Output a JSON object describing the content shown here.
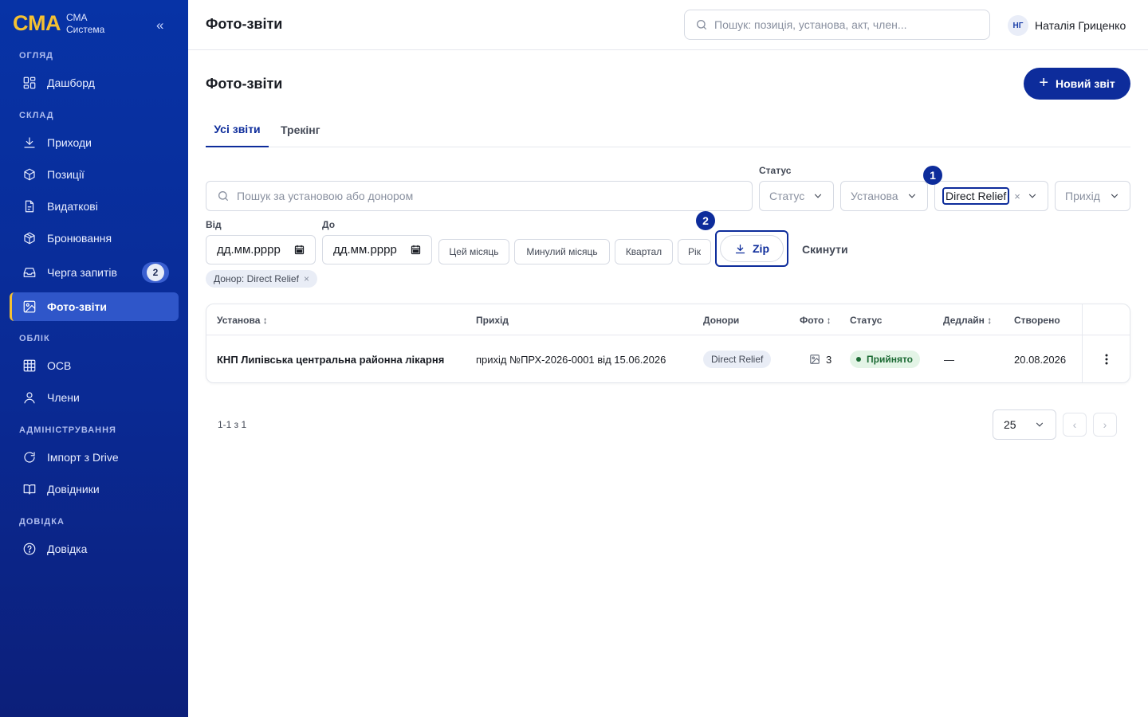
{
  "sidebar": {
    "logo": "CMA",
    "brand_line1": "СМА",
    "brand_line2": "Система",
    "collapse": "«",
    "sections": {
      "overview": "ОГЛЯД",
      "warehouse": "СКЛАД",
      "accounting": "ОБЛІК",
      "admin": "АДМІНІСТРУВАННЯ",
      "help": "ДОВІДКА"
    },
    "items": {
      "dashboard": "Дашборд",
      "incoming": "Приходи",
      "positions": "Позиції",
      "outgoing": "Видаткові",
      "booking": "Бронювання",
      "queue": "Черга запитів",
      "queue_count": "2",
      "photo_reports": "Фото-звіти",
      "osv": "ОСВ",
      "members": "Члени",
      "import": "Імпорт з Drive",
      "references": "Довідники",
      "help": "Довідка"
    }
  },
  "topbar": {
    "title": "Фото-звіти",
    "search_placeholder": "Пошук: позиція, установа, акт, член...",
    "user_initials": "НГ",
    "user_name": "Наталія Гриценко"
  },
  "page": {
    "title": "Фото-звіти",
    "new_button": "Новий звіт",
    "tabs": [
      "Усі звіти",
      "Трекінг"
    ]
  },
  "filters": {
    "search_placeholder": "Пошук за установою або донором",
    "status_label": "Статус",
    "status_placeholder": "Статус",
    "institution_placeholder": "Установа",
    "donor_value": "Direct Relief",
    "donor_clear": "×",
    "income_placeholder": "Прихід",
    "from_label": "Від",
    "to_label": "До",
    "date_placeholder": "дд.мм.рррр",
    "chips": [
      "Цей місяць",
      "Минулий місяць",
      "Квартал",
      "Рік"
    ],
    "zip_label": "Zip",
    "reset_label": "Скинути",
    "active_chip": "Донор: Direct Relief",
    "active_chip_x": "×",
    "markers": [
      "1",
      "2"
    ]
  },
  "table": {
    "headers": [
      "Установа ↕",
      "Прихід",
      "Донори",
      "Фото ↕",
      "Статус",
      "Дедлайн ↕",
      "Створено"
    ],
    "rows": [
      {
        "institution": "КНП Липівська центральна районна лікарня",
        "income": "прихід №ПРХ-2026-0001 від 15.06.2026",
        "donor": "Direct Relief",
        "photos": "3",
        "status": "Прийнято",
        "deadline": "—",
        "created": "20.08.2026"
      }
    ]
  },
  "pagination": {
    "range": "1-1 з 1",
    "per_page": "25",
    "prev": "‹",
    "next": "›"
  },
  "colors": {
    "sidebar_bg": "#0733a6",
    "accent": "#0d2c9b",
    "logo_yellow": "#f5c132",
    "status_green": "#1d6b35"
  }
}
